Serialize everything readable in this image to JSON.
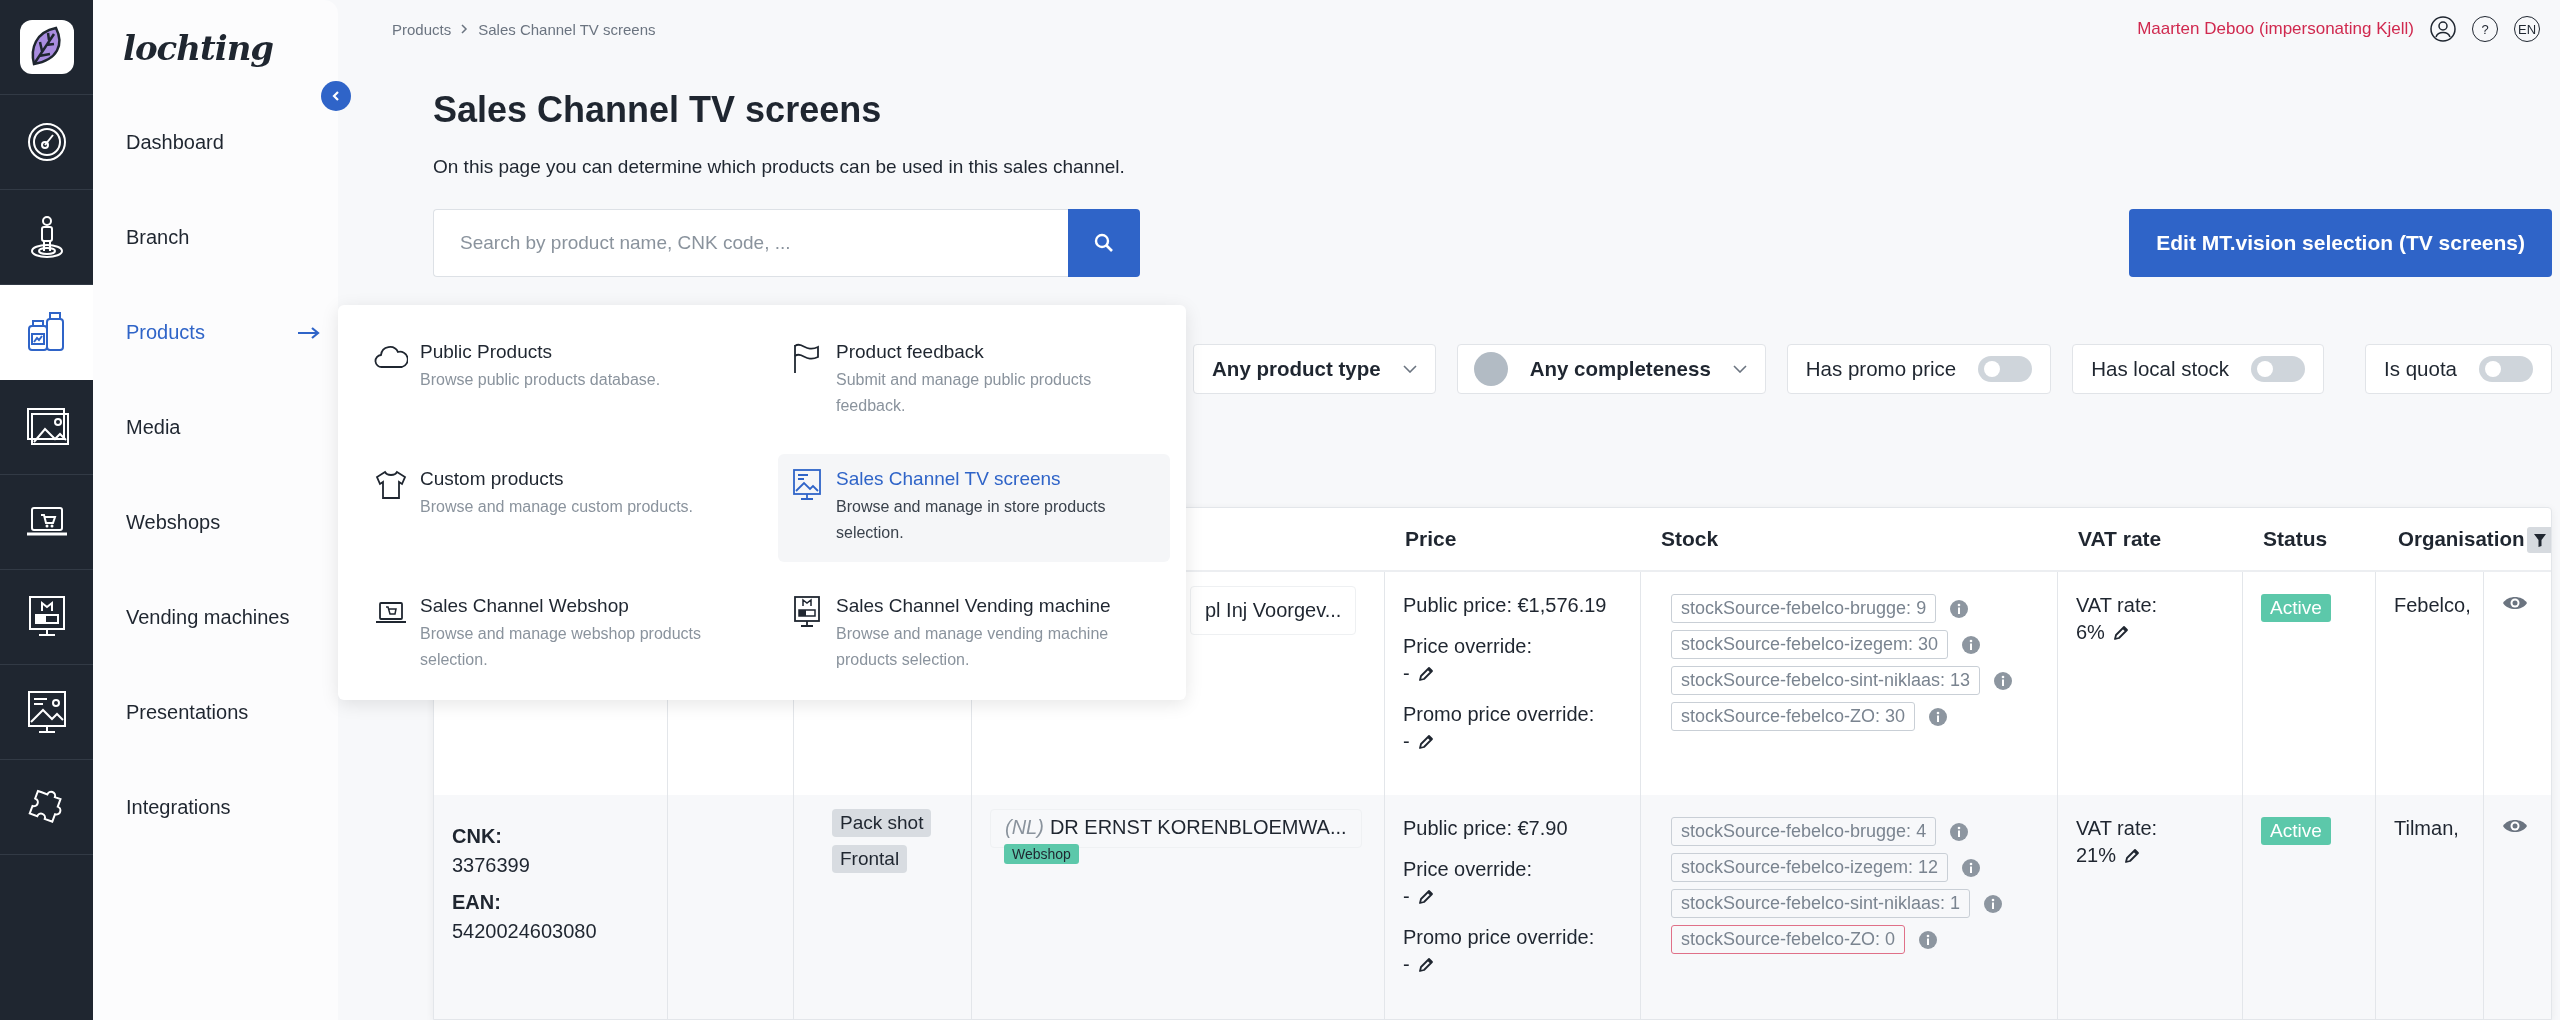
{
  "brand": {
    "name": "lochting"
  },
  "nav": [
    {
      "label": "Dashboard",
      "selected": false
    },
    {
      "label": "Branch",
      "selected": false
    },
    {
      "label": "Products",
      "selected": true
    },
    {
      "label": "Media",
      "selected": false
    },
    {
      "label": "Webshops",
      "selected": false
    },
    {
      "label": "Vending machines",
      "selected": false
    },
    {
      "label": "Presentations",
      "selected": false
    },
    {
      "label": "Integrations",
      "selected": false
    }
  ],
  "breadcrumb": [
    "Products",
    "Sales Channel TV screens"
  ],
  "user": {
    "name": "Maarten Deboo (impersonating Kjell)",
    "help": "?",
    "language": "EN"
  },
  "page": {
    "title": "Sales Channel TV screens",
    "description": "On this page you can determine which products can be used in this sales channel.",
    "search": {
      "placeholder": "Search by product name, CNK code, ..."
    },
    "action": "Edit MT.vision selection (TV screens)"
  },
  "filters": [
    {
      "kind": "select",
      "label": "Any product type"
    },
    {
      "kind": "completeness",
      "label": "Any completeness"
    },
    {
      "kind": "toggle",
      "label": "Has promo price",
      "on": false
    },
    {
      "kind": "toggle",
      "label": "Has local stock",
      "on": false
    },
    {
      "kind": "toggle",
      "label": "Is quota",
      "on": false
    }
  ],
  "menu": [
    {
      "title": "Public Products",
      "description": "Browse public products database.",
      "selected": false
    },
    {
      "title": "Product feedback",
      "description": "Submit and manage public products feedback.",
      "selected": false
    },
    {
      "title": "Custom products",
      "description": "Browse and manage custom products.",
      "selected": false
    },
    {
      "title": "Sales Channel TV screens",
      "description": "Browse and manage in store products selection.",
      "selected": true
    },
    {
      "title": "Sales Channel Webshop",
      "description": "Browse and manage webshop products selection.",
      "selected": false
    },
    {
      "title": "Sales Channel Vending machine",
      "description": "Browse and manage vending machine products selection.",
      "selected": false
    }
  ],
  "table": {
    "headers": [
      "Price",
      "Stock",
      "VAT rate",
      "Status",
      "Organisation"
    ],
    "rows": [
      {
        "name": {
          "text": "pl Inj Voorgev..."
        },
        "price": {
          "public": "Public price: €1,576.19",
          "override_label": "Price override:",
          "override": "-",
          "promo_label": "Promo price override:",
          "promo": "-"
        },
        "stock": [
          {
            "text": "stockSource-febelco-brugge: 9",
            "out_of_stock": false
          },
          {
            "text": "stockSource-febelco-izegem: 30",
            "out_of_stock": false
          },
          {
            "text": "stockSource-febelco-sint-niklaas: 13",
            "out_of_stock": false
          },
          {
            "text": "stockSource-febelco-ZO: 30",
            "out_of_stock": false
          }
        ],
        "vat": {
          "label": "VAT rate:",
          "value": "6%"
        },
        "status": "Active",
        "organisation": "Febelco,"
      },
      {
        "codes": [
          {
            "label": "CNK:",
            "value": "3376399"
          },
          {
            "label": "EAN:",
            "value": "5420024603080"
          }
        ],
        "images": [
          "Pack shot",
          "Frontal"
        ],
        "name": {
          "language": "(NL)",
          "text": "DR ERNST KORENBLOEMWA...",
          "tags": [
            "Webshop"
          ]
        },
        "price": {
          "public": "Public price: €7.90",
          "override_label": "Price override:",
          "override": "-",
          "promo_label": "Promo price override:",
          "promo": "-"
        },
        "stock": [
          {
            "text": "stockSource-febelco-brugge: 4",
            "out_of_stock": false
          },
          {
            "text": "stockSource-febelco-izegem: 12",
            "out_of_stock": false
          },
          {
            "text": "stockSource-febelco-sint-niklaas: 1",
            "out_of_stock": false
          },
          {
            "text": "stockSource-febelco-ZO: 0",
            "out_of_stock": true
          }
        ],
        "vat": {
          "label": "VAT rate:",
          "value": "21%"
        },
        "status": "Active",
        "organisation": "Tilman,"
      }
    ]
  }
}
